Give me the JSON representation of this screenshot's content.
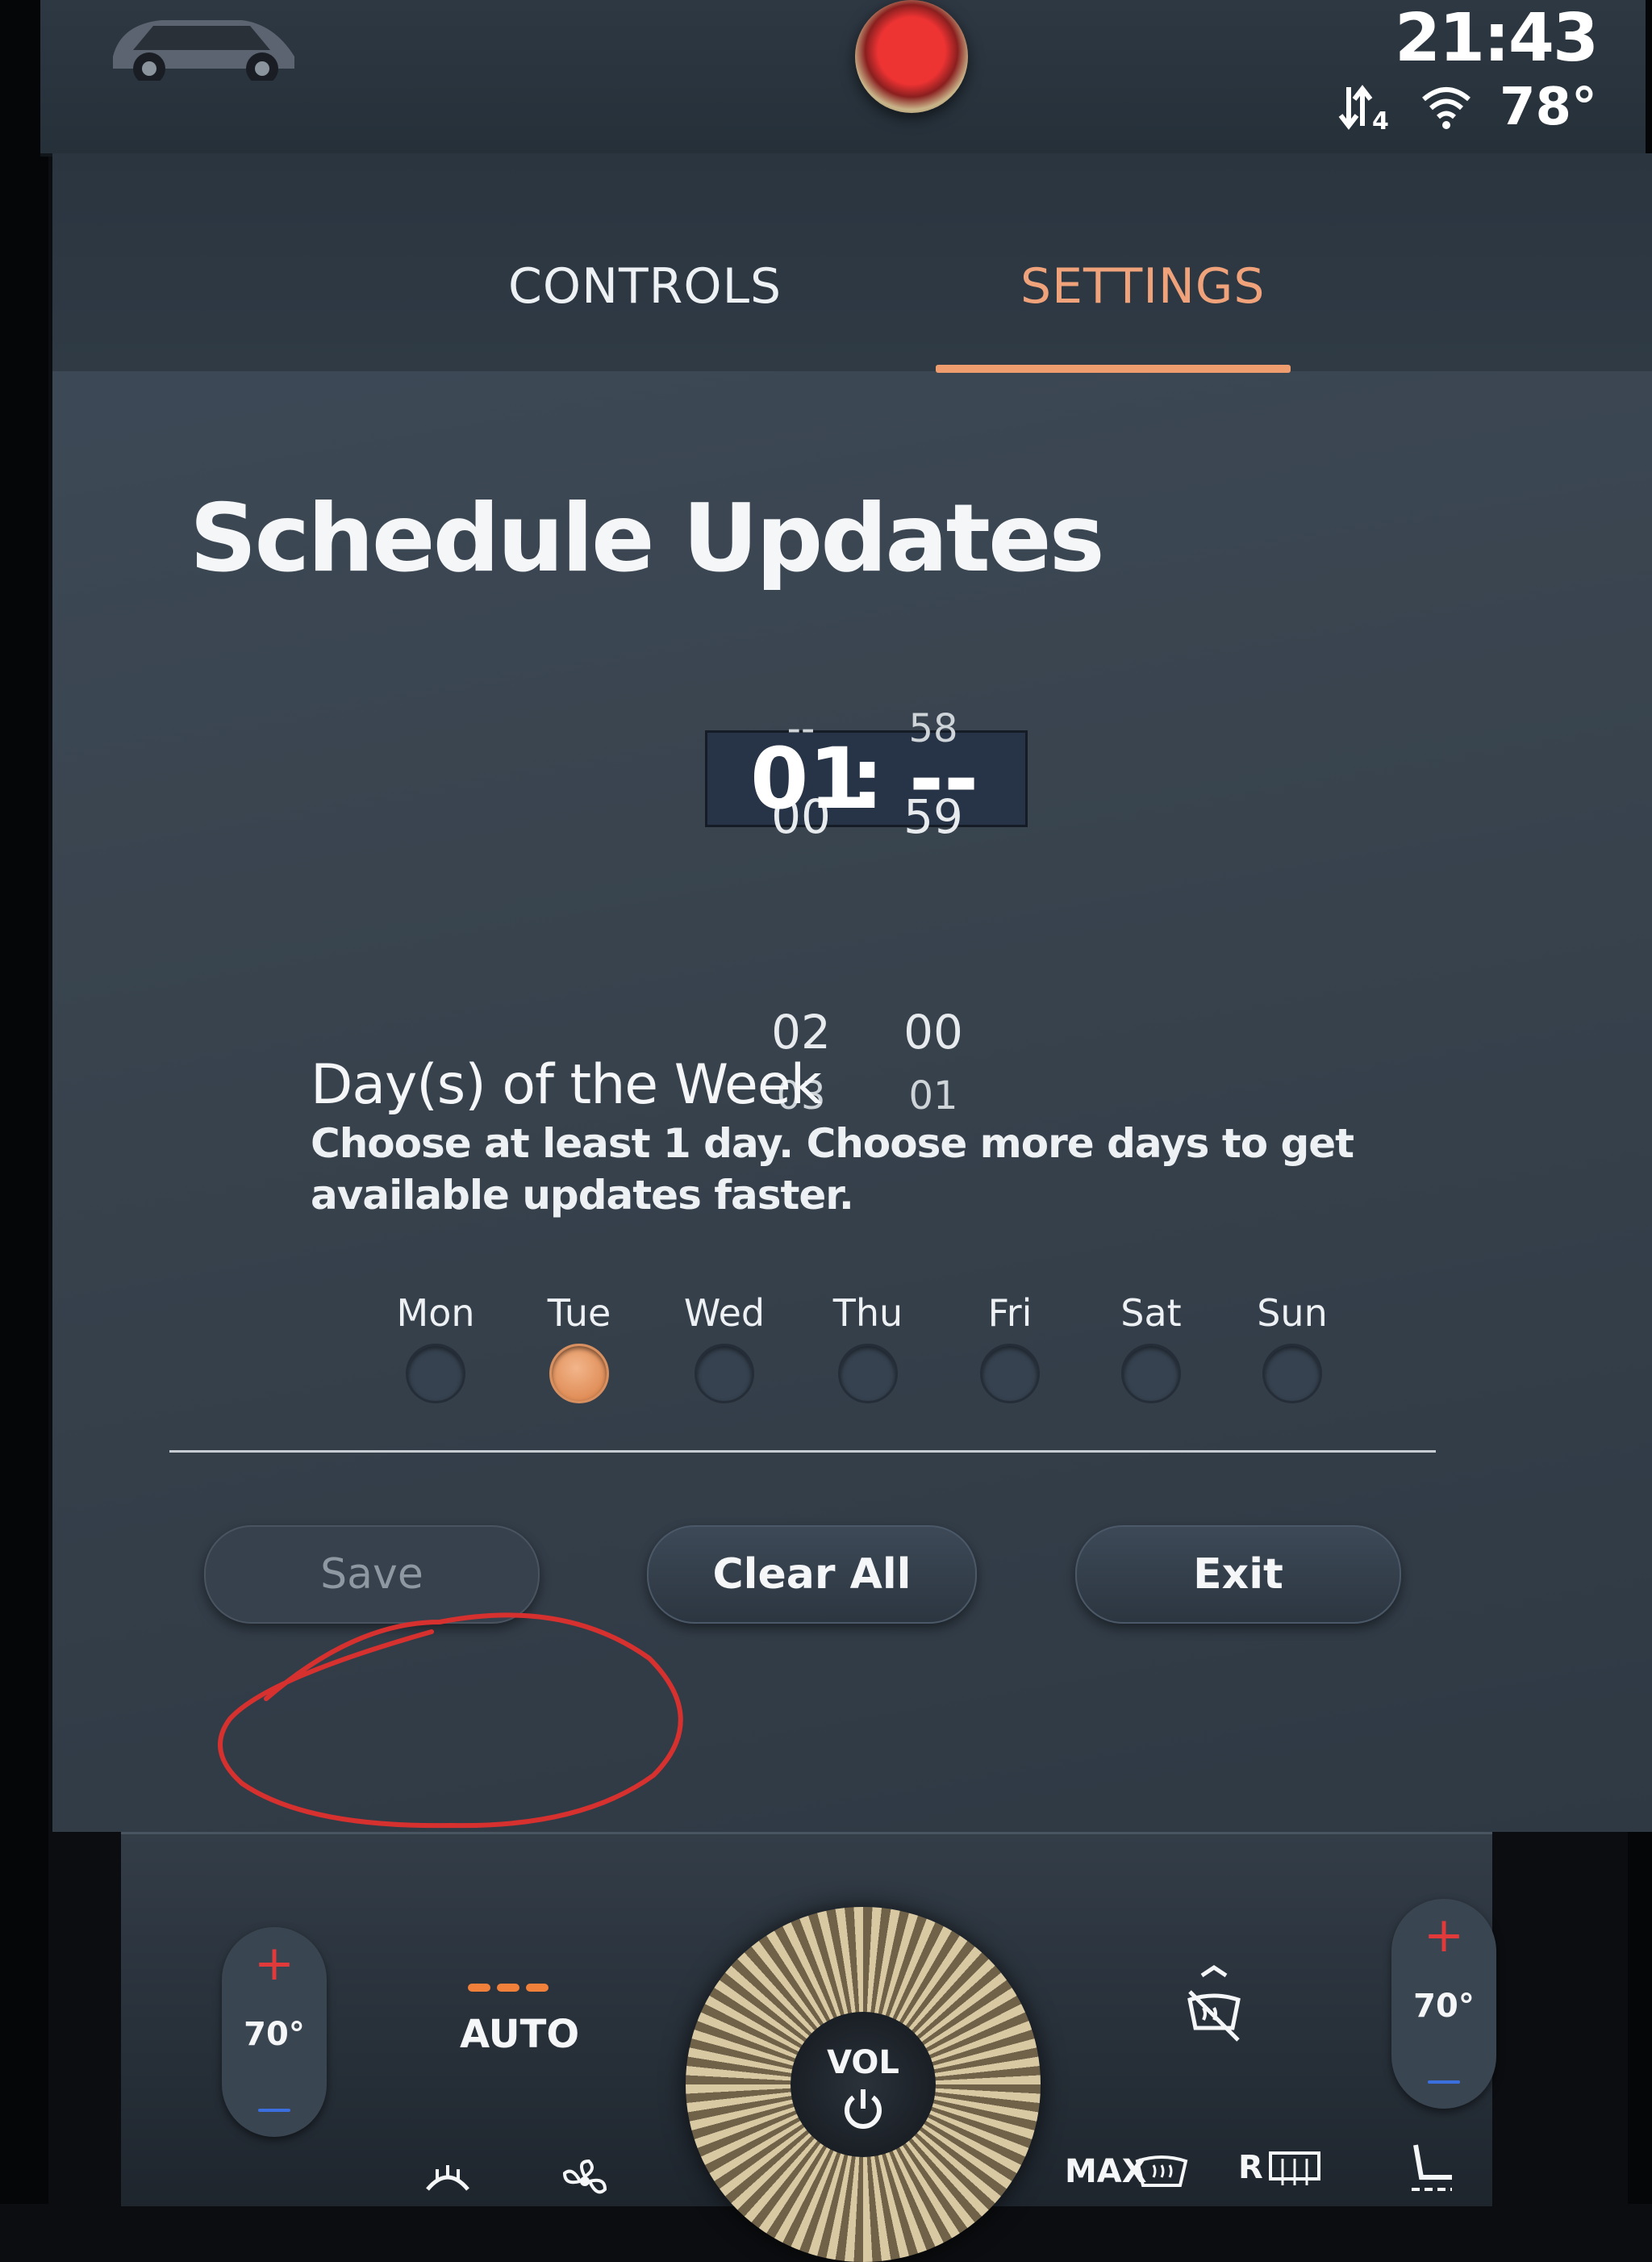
{
  "status": {
    "clock": "21:43",
    "outside_temp": "78°"
  },
  "tabs": [
    {
      "label": "CONTROLS",
      "active": false
    },
    {
      "label": "SETTINGS",
      "active": true
    }
  ],
  "accent_color": "#ef9d6e",
  "page": {
    "title": "Schedule Updates"
  },
  "time_picker": {
    "hours": {
      "far_above": "--",
      "above": "00",
      "selected": "01",
      "below": "02",
      "far_below": "03"
    },
    "separator": ":",
    "minutes": {
      "far_above": "58",
      "above": "59",
      "selected": "--",
      "below": "00",
      "far_below": "01"
    }
  },
  "days_section": {
    "title": "Day(s) of the Week",
    "subtitle": "Choose at least 1 day. Choose more days to get available updates faster.",
    "days": [
      {
        "label": "Mon",
        "selected": false
      },
      {
        "label": "Tue",
        "selected": true
      },
      {
        "label": "Wed",
        "selected": false
      },
      {
        "label": "Thu",
        "selected": false
      },
      {
        "label": "Fri",
        "selected": false
      },
      {
        "label": "Sat",
        "selected": false
      },
      {
        "label": "Sun",
        "selected": false
      }
    ]
  },
  "buttons": {
    "save": "Save",
    "clear_all": "Clear All",
    "exit": "Exit"
  },
  "climate": {
    "left_temp": "70°",
    "right_temp": "70°",
    "plus": "+",
    "auto_label": "AUTO",
    "vol_label": "VOL",
    "max_defrost_label": "MAX",
    "rear_defrost_label": "R"
  }
}
